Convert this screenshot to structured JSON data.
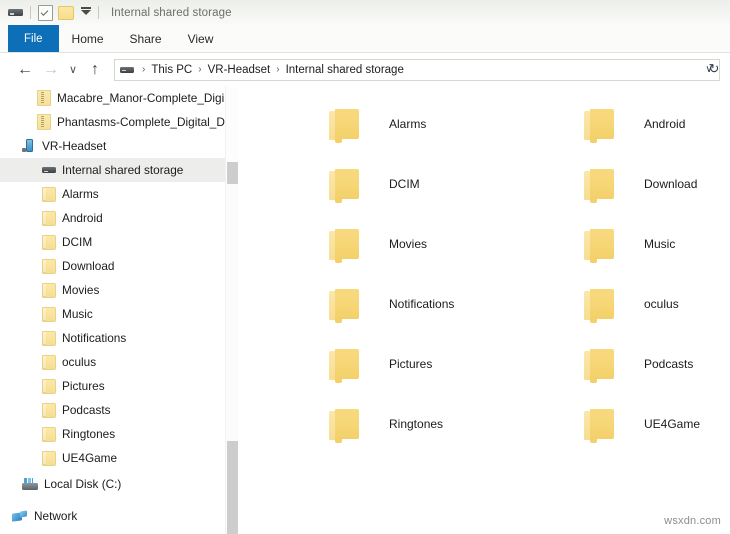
{
  "window": {
    "title": "Internal shared storage",
    "accent_color": "#0d6fb8",
    "folder_color": "#f6d675"
  },
  "quick_access": {
    "items": [
      {
        "name": "drive-icon",
        "label": ""
      },
      {
        "name": "properties-icon",
        "label": ""
      },
      {
        "name": "new-folder-icon",
        "label": ""
      },
      {
        "name": "customize-dropdown-icon",
        "label": ""
      }
    ]
  },
  "ribbon": {
    "tabs": [
      {
        "label": "File",
        "active": true
      },
      {
        "label": "Home",
        "active": false
      },
      {
        "label": "Share",
        "active": false
      },
      {
        "label": "View",
        "active": false
      }
    ]
  },
  "navigation": {
    "back": "←",
    "forward": "→",
    "history": "∨",
    "up": "↑",
    "refresh": "↻",
    "dropdown": "∨",
    "breadcrumbs": [
      "This PC",
      "VR-Headset",
      "Internal shared storage"
    ],
    "separator": "›"
  },
  "sidebar": {
    "items": [
      {
        "label": "Macabre_Manor-Complete_Digi",
        "icon": "zip-folder-icon",
        "indent": 1,
        "selected": false,
        "truncated": true
      },
      {
        "label": "Phantasms-Complete_Digital_D",
        "icon": "zip-folder-icon",
        "indent": 1,
        "selected": false,
        "truncated": true
      },
      {
        "label": "VR-Headset",
        "icon": "phone-icon",
        "indent": 2,
        "selected": false
      },
      {
        "label": "Internal shared storage",
        "icon": "storage-icon",
        "indent": 3,
        "selected": true
      },
      {
        "label": "Alarms",
        "icon": "folder-icon",
        "indent": 1,
        "selected": false
      },
      {
        "label": "Android",
        "icon": "folder-icon",
        "indent": 1,
        "selected": false
      },
      {
        "label": "DCIM",
        "icon": "folder-icon",
        "indent": 1,
        "selected": false
      },
      {
        "label": "Download",
        "icon": "folder-icon",
        "indent": 1,
        "selected": false
      },
      {
        "label": "Movies",
        "icon": "folder-icon",
        "indent": 1,
        "selected": false
      },
      {
        "label": "Music",
        "icon": "folder-icon",
        "indent": 1,
        "selected": false
      },
      {
        "label": "Notifications",
        "icon": "folder-icon",
        "indent": 1,
        "selected": false
      },
      {
        "label": "oculus",
        "icon": "folder-icon",
        "indent": 1,
        "selected": false
      },
      {
        "label": "Pictures",
        "icon": "folder-icon",
        "indent": 1,
        "selected": false
      },
      {
        "label": "Podcasts",
        "icon": "folder-icon",
        "indent": 1,
        "selected": false
      },
      {
        "label": "Ringtones",
        "icon": "folder-icon",
        "indent": 1,
        "selected": false
      },
      {
        "label": "UE4Game",
        "icon": "folder-icon",
        "indent": 1,
        "selected": false
      },
      {
        "label": "Local Disk (C:)",
        "icon": "disk-icon",
        "indent": 4,
        "selected": false
      },
      {
        "label": "Network",
        "icon": "network-icon",
        "indent": 4,
        "selected": false
      }
    ],
    "scroll_caret": "^"
  },
  "files": {
    "items": [
      {
        "label": "Alarms",
        "icon": "folder-icon"
      },
      {
        "label": "Android",
        "icon": "folder-icon"
      },
      {
        "label": "DCIM",
        "icon": "folder-icon"
      },
      {
        "label": "Download",
        "icon": "folder-icon"
      },
      {
        "label": "Movies",
        "icon": "folder-icon"
      },
      {
        "label": "Music",
        "icon": "folder-icon"
      },
      {
        "label": "Notifications",
        "icon": "folder-icon"
      },
      {
        "label": "oculus",
        "icon": "folder-icon"
      },
      {
        "label": "Pictures",
        "icon": "folder-icon"
      },
      {
        "label": "Podcasts",
        "icon": "folder-icon"
      },
      {
        "label": "Ringtones",
        "icon": "folder-icon"
      },
      {
        "label": "UE4Game",
        "icon": "folder-icon"
      }
    ]
  },
  "watermark": {
    "text": "wsxdn.com"
  }
}
